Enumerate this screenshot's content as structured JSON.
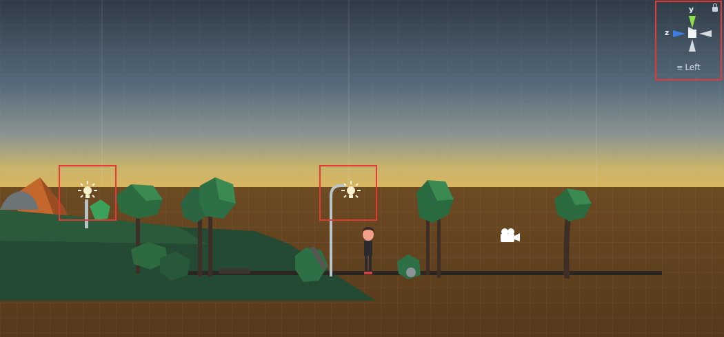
{
  "scene_view": {
    "orientation_gizmo": {
      "axis_y_label": "y",
      "axis_z_label": "z",
      "view_label": "Left",
      "view_menu_icon": "hamburger-menu-icon",
      "lock_icon": "lock-icon"
    },
    "gizmo_icons": [
      {
        "name": "light-bulb-icon",
        "highlighted": true
      },
      {
        "name": "light-bulb-icon",
        "highlighted": true
      },
      {
        "name": "camera-icon",
        "highlighted": false
      }
    ],
    "highlight_color": "#e53935",
    "colors": {
      "sky_top": "#2f3b46",
      "sky_horizon": "#c9b46a",
      "ground": "#5a3d20",
      "hill": "#244a33",
      "tree": "#2c6a3f",
      "axis_y": "#8ee04a",
      "axis_z": "#3b7fe6"
    }
  }
}
